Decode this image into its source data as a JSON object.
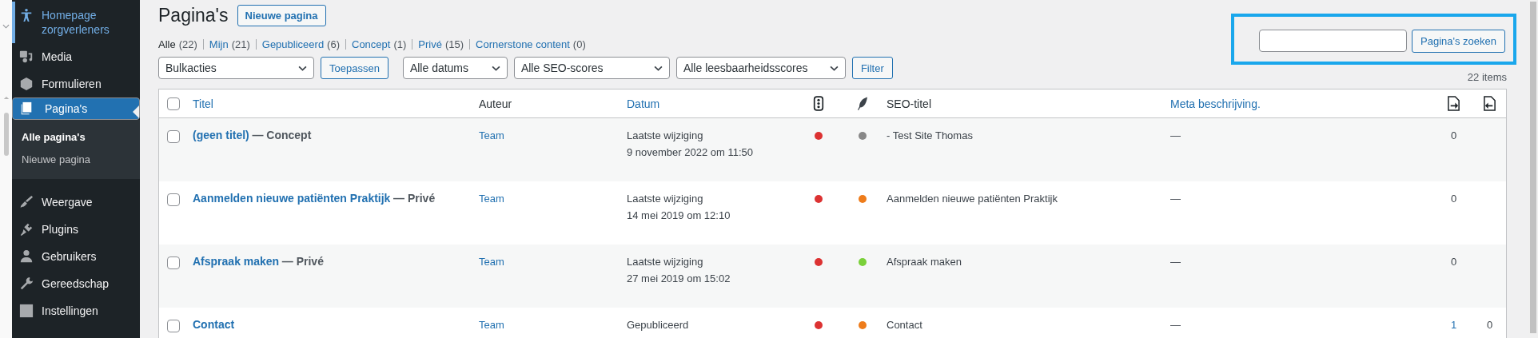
{
  "sidebar": {
    "items": [
      {
        "label": "Homepage zorgverleners",
        "selected": false,
        "hover": true
      },
      {
        "label": "Media",
        "selected": false,
        "hover": false
      },
      {
        "label": "Formulieren",
        "selected": false,
        "hover": false
      },
      {
        "label": "Pagina's",
        "selected": true,
        "hover": false,
        "children": [
          {
            "label": "Alle pagina's",
            "selected": true
          },
          {
            "label": "Nieuwe pagina",
            "selected": false
          }
        ]
      },
      {
        "label": "Weergave",
        "selected": false,
        "hover": false
      },
      {
        "label": "Plugins",
        "selected": false,
        "hover": false
      },
      {
        "label": "Gebruikers",
        "selected": false,
        "hover": false
      },
      {
        "label": "Gereedschap",
        "selected": false,
        "hover": false
      },
      {
        "label": "Instellingen",
        "selected": false,
        "hover": false
      }
    ]
  },
  "page": {
    "title": "Pagina's",
    "add_button": "Nieuwe pagina"
  },
  "views": [
    {
      "label": "Alle",
      "count": "(22)",
      "selected": true
    },
    {
      "label": "Mijn",
      "count": "(21)",
      "selected": false
    },
    {
      "label": "Gepubliceerd",
      "count": "(6)",
      "selected": false
    },
    {
      "label": "Concept",
      "count": "(1)",
      "selected": false
    },
    {
      "label": "Privé",
      "count": "(15)",
      "selected": false
    },
    {
      "label": "Cornerstone content",
      "count": "(0)",
      "selected": false
    }
  ],
  "bulk": {
    "select": "Bulkacties",
    "button": "Toepassen"
  },
  "filters": {
    "selects": [
      "Alle datums",
      "Alle SEO-scores",
      "Alle leesbaarheidsscores"
    ],
    "button": "Filter"
  },
  "search": {
    "button": "Pagina's zoeken",
    "highlighted": true
  },
  "item_count": "22 items",
  "table": {
    "checked": false,
    "columns": [
      {
        "label": "Titel",
        "sortable": true
      },
      {
        "label": "Auteur",
        "sortable": false
      },
      {
        "label": "Datum",
        "sortable": true
      },
      {
        "label": "SEO-titel",
        "sortable": false
      },
      {
        "label": "Meta beschrijving.",
        "sortable": true
      }
    ],
    "rows": [
      {
        "checked": false,
        "title": "(geen titel)",
        "state": "— Concept",
        "author": "Team",
        "date_status": "Laatste wijziging",
        "date": "9 november 2022 om 11:50",
        "seo_score": {
          "color": "#dc3232"
        },
        "readability": {
          "color": "#888888"
        },
        "seo_title": "- Test Site Thomas",
        "meta": "—",
        "links": "0"
      },
      {
        "checked": false,
        "title": "Aanmelden nieuwe patiënten Praktijk",
        "state": "— Privé",
        "author": "Team",
        "date_status": "Laatste wijziging",
        "date": "14 mei 2019 om 12:10",
        "seo_score": {
          "color": "#dc3232"
        },
        "readability": {
          "color": "#ee7c1b"
        },
        "seo_title": "Aanmelden nieuwe patiënten Praktijk",
        "meta": "—",
        "links": "0"
      },
      {
        "checked": false,
        "title": "Afspraak maken",
        "state": "— Privé",
        "author": "Team",
        "date_status": "Laatste wijziging",
        "date": "27 mei 2019 om 15:02",
        "seo_score": {
          "color": "#dc3232"
        },
        "readability": {
          "color": "#7ad03a"
        },
        "seo_title": "Afspraak maken",
        "meta": "—",
        "links": "0"
      },
      {
        "checked": false,
        "title": "Contact",
        "author": "Team",
        "date_status": "Gepubliceerd",
        "seo_score": {
          "color": "#dc3232"
        },
        "readability": {
          "color": "#ee7c1b"
        },
        "seo_title": "Contact",
        "meta": "—",
        "links": "1",
        "linked": "0"
      }
    ]
  }
}
